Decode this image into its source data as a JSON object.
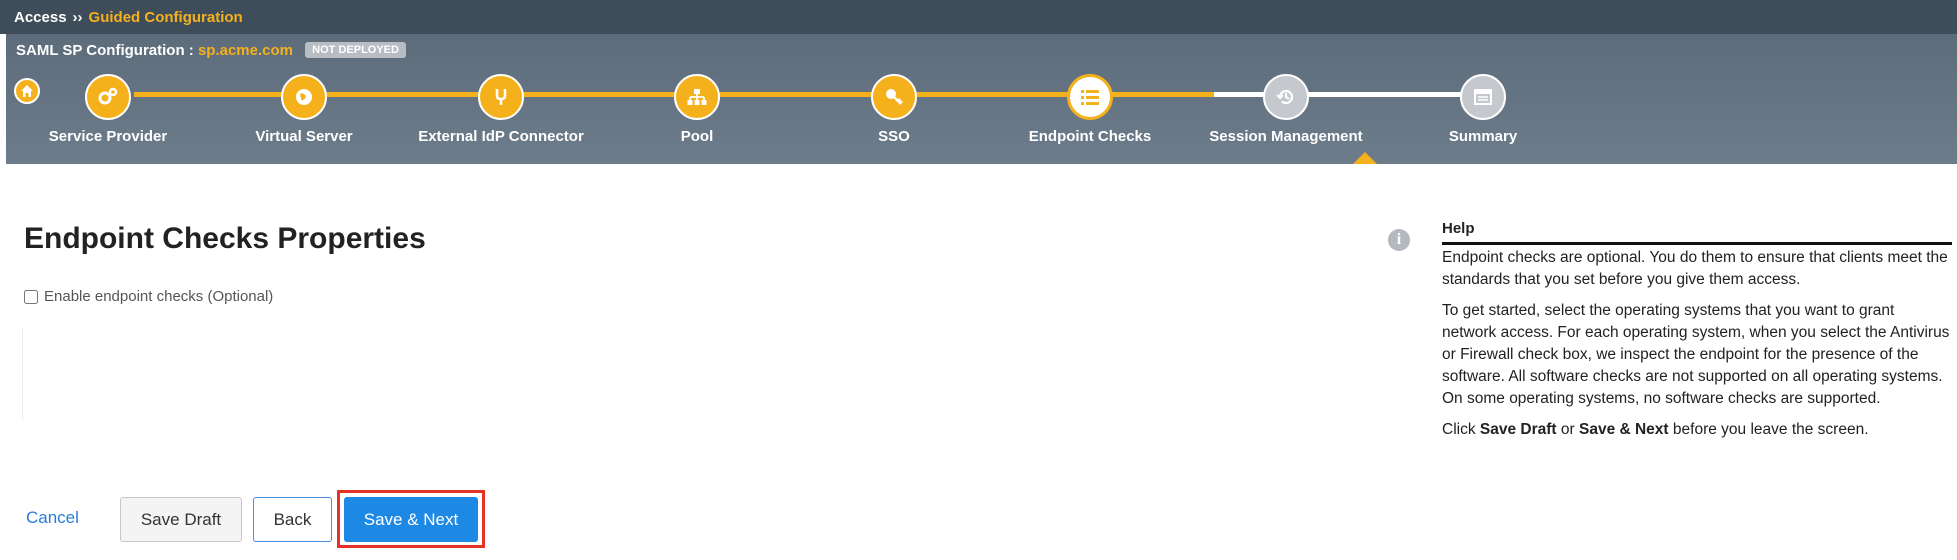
{
  "breadcrumb": {
    "root": "Access",
    "separator": "››",
    "current": "Guided Configuration"
  },
  "config": {
    "prefix": "SAML SP Configuration : ",
    "host": "sp.acme.com",
    "status_badge": "NOT DEPLOYED"
  },
  "wizard": {
    "home_icon": "home-icon",
    "accent_color": "#f5b11b",
    "steps": [
      {
        "label": "Service Provider",
        "icon": "gears-icon",
        "state": "completed"
      },
      {
        "label": "Virtual Server",
        "icon": "globe-icon",
        "state": "completed"
      },
      {
        "label": "External IdP Connector",
        "icon": "fork-icon",
        "state": "completed"
      },
      {
        "label": "Pool",
        "icon": "network-icon",
        "state": "completed"
      },
      {
        "label": "SSO",
        "icon": "key-icon",
        "state": "completed"
      },
      {
        "label": "Endpoint Checks",
        "icon": "list-icon",
        "state": "current"
      },
      {
        "label": "Session Management",
        "icon": "history-icon",
        "state": "pending"
      },
      {
        "label": "Summary",
        "icon": "window-icon",
        "state": "pending"
      }
    ]
  },
  "main": {
    "title": "Endpoint Checks Properties",
    "checkbox_label": "Enable endpoint checks (Optional)",
    "checkbox_checked": false
  },
  "actions": {
    "cancel": "Cancel",
    "save_draft": "Save Draft",
    "back": "Back",
    "save_next": "Save & Next",
    "primary_color": "#1e88e5",
    "highlight_color": "#e53323"
  },
  "help": {
    "title": "Help",
    "p1": "Endpoint checks are optional. You do them to ensure that clients meet the standards that you set before you give them access.",
    "p2": "To get started, select the operating systems that you want to grant network access. For each operating system, when you select the Antivirus or Firewall check box, we inspect the endpoint for the presence of the software. All software checks are not supported on all operating systems. On some operating systems, no software checks are supported.",
    "p3_click": "Click ",
    "p3_save_draft": "Save Draft",
    "p3_or": " or ",
    "p3_save_next": "Save & Next",
    "p3_end": " before you leave the screen."
  }
}
